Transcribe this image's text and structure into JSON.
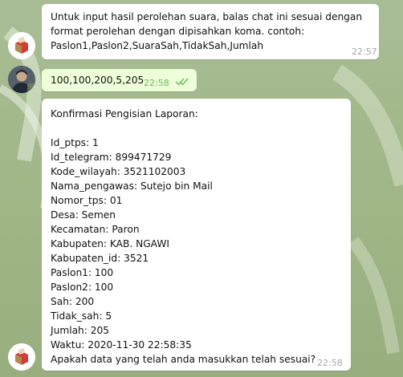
{
  "chat": {
    "messages": [
      {
        "sender": "bot",
        "text": "Untuk input hasil perolehan suara, balas chat ini sesuai dengan\nformat perolehan dengan dipisahkan koma. contoh:\nPaslon1,Paslon2,SuaraSah,TidakSah,Jumlah",
        "time": "22:57"
      },
      {
        "sender": "user",
        "text": "100,100,200,5,205",
        "time": "22:58",
        "status": "read-double-check-icon"
      },
      {
        "sender": "bot",
        "lines": [
          "Konfirmasi Pengisian Laporan:",
          "",
          "Id_ptps: 1",
          "Id_telegram: 899471729",
          "Kode_wilayah: 3521102003",
          "Nama_pengawas: Sutejo bin Mail",
          "Nomor_tps: 01",
          "Desa: Semen",
          "Kecamatan: Paron",
          "Kabupaten: KAB. NGAWI",
          "Kabupaten_id: 3521",
          "Paslon1: 100",
          "Paslon2: 100",
          "Sah: 200",
          "Tidak_sah: 5",
          "Jumlah: 205",
          "Waktu: 2020-11-30 22:58:35",
          "Apakah data yang telah anda masukkan telah sesuai?"
        ],
        "time": "22:58"
      }
    ]
  },
  "colors": {
    "incoming_bubble": "#ffffff",
    "outgoing_bubble": "#eefed8",
    "outgoing_time": "#6dba5c",
    "bot_logo_red": "#d13b36",
    "bot_logo_gold": "#b48a4a"
  }
}
